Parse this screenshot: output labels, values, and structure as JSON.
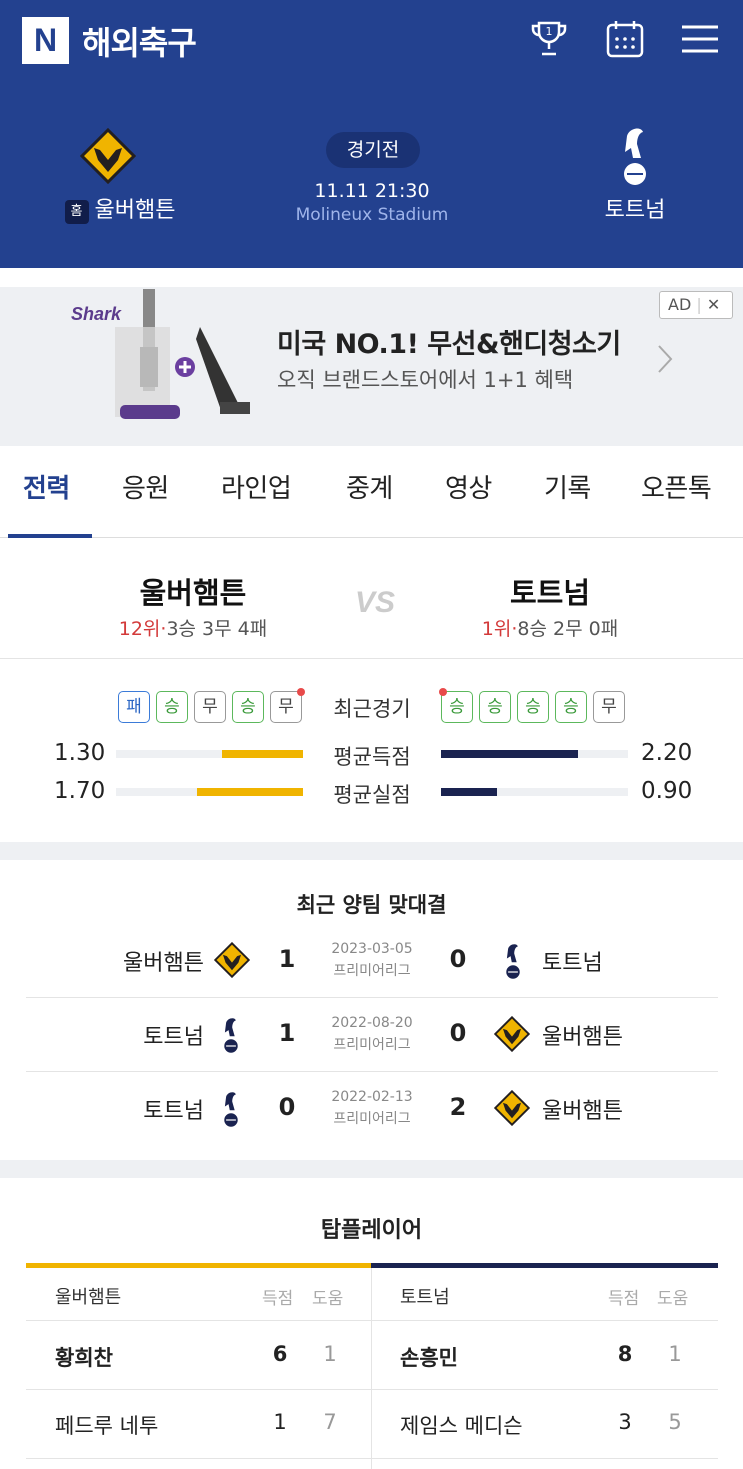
{
  "header": {
    "logo": "N",
    "title": "해외축구",
    "trophy_number": "1"
  },
  "match": {
    "home": {
      "badge": "홈",
      "name": "울버햄튼"
    },
    "away": {
      "name": "토트넘"
    },
    "status": "경기전",
    "datetime": "11.11 21:30",
    "stadium": "Molineux Stadium"
  },
  "ad": {
    "brand": "Shark",
    "title": "미국 NO.1! 무선&핸디청소기",
    "subtitle": "오직 브랜드스토어에서 1+1 혜택",
    "badge": "AD",
    "close": "✕"
  },
  "tabs": [
    "전력",
    "응원",
    "라인업",
    "중계",
    "영상",
    "기록",
    "오픈톡"
  ],
  "comparison": {
    "vs": "VS",
    "home": {
      "name": "울버햄튼",
      "rank": "12위",
      "sep": "·",
      "record": "3승 3무 4패"
    },
    "away": {
      "name": "토트넘",
      "rank": "1위",
      "sep": "·",
      "record": "8승 2무 0패"
    },
    "recent_label": "최근경기",
    "home_form": [
      "패",
      "승",
      "무",
      "승",
      "무"
    ],
    "away_form": [
      "승",
      "승",
      "승",
      "승",
      "무"
    ],
    "stats": [
      {
        "label": "평균득점",
        "home": "1.30",
        "away": "2.20",
        "home_val": 1.3,
        "away_val": 2.2
      },
      {
        "label": "평균실점",
        "home": "1.70",
        "away": "0.90",
        "home_val": 1.7,
        "away_val": 0.9
      }
    ],
    "colors": {
      "home": "#f0b400",
      "away": "#1a2350"
    }
  },
  "h2h": {
    "title": "최근 양팀 맞대결",
    "matches": [
      {
        "left": "울버햄튼",
        "left_crest": "wolves",
        "left_score": "1",
        "date": "2023-03-05",
        "league": "프리미어리그",
        "right_score": "0",
        "right": "토트넘",
        "right_crest": "spurs"
      },
      {
        "left": "토트넘",
        "left_crest": "spurs",
        "left_score": "1",
        "date": "2022-08-20",
        "league": "프리미어리그",
        "right_score": "0",
        "right": "울버햄튼",
        "right_crest": "wolves"
      },
      {
        "left": "토트넘",
        "left_crest": "spurs",
        "left_score": "0",
        "date": "2022-02-13",
        "league": "프리미어리그",
        "right_score": "2",
        "right": "울버햄튼",
        "right_crest": "wolves"
      }
    ]
  },
  "top_players": {
    "title": "탑플레이어",
    "goals_label": "득점",
    "assists_label": "도움",
    "home": {
      "team": "울버햄튼",
      "players": [
        {
          "name": "황희찬",
          "goals": "6",
          "assists": "1"
        },
        {
          "name": "페드루 네투",
          "goals": "1",
          "assists": "7"
        }
      ]
    },
    "away": {
      "team": "토트넘",
      "players": [
        {
          "name": "손흥민",
          "goals": "8",
          "assists": "1"
        },
        {
          "name": "제임스 메디슨",
          "goals": "3",
          "assists": "5"
        }
      ]
    }
  }
}
